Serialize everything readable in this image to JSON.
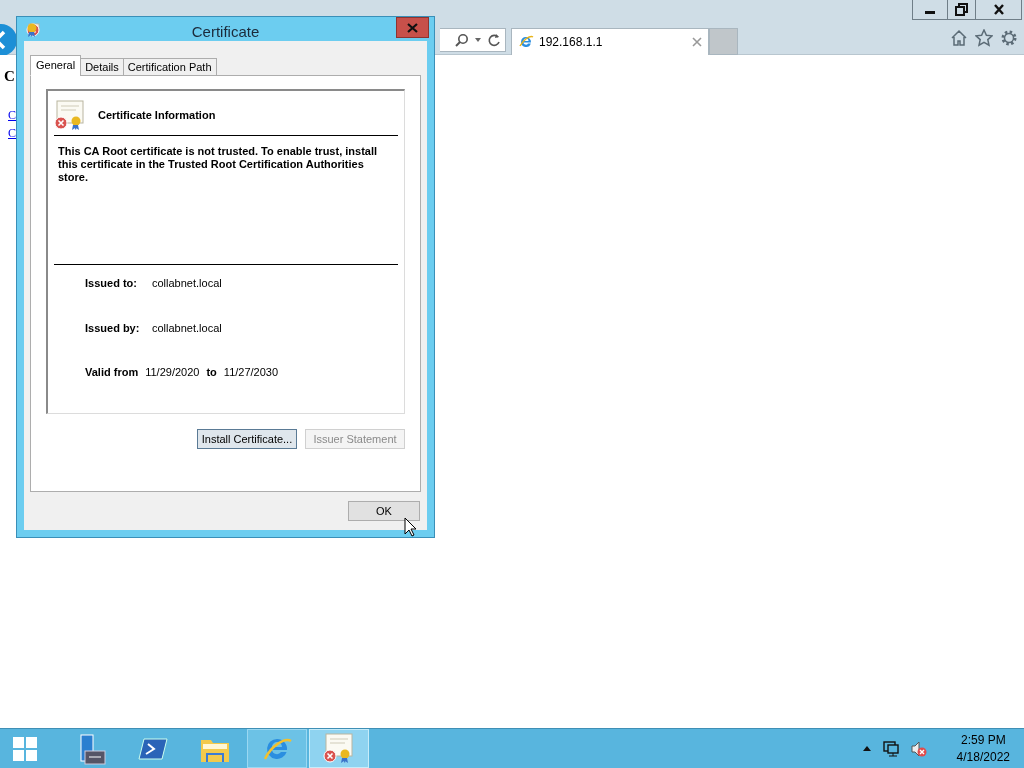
{
  "browser": {
    "page": {
      "heading": "C",
      "links": [
        "C",
        "C"
      ]
    },
    "tab": {
      "title": "192.168.1.1"
    }
  },
  "dialog": {
    "title": "Certificate",
    "tabs": [
      {
        "label": "General",
        "selected": true
      },
      {
        "label": "Details",
        "selected": false
      },
      {
        "label": "Certification Path",
        "selected": false
      }
    ],
    "info_title": "Certificate Information",
    "message": "This CA Root certificate is not trusted. To enable trust, install this certificate in the Trusted Root Certification Authorities store.",
    "fields": [
      {
        "label": "Issued to:",
        "value": "collabnet.local"
      },
      {
        "label": "Issued by:",
        "value": "collabnet.local"
      }
    ],
    "valid": {
      "label": "Valid from",
      "from": "11/29/2020",
      "to_label": "to",
      "to": "11/27/2030"
    },
    "buttons": [
      {
        "label": "Install Certificate...",
        "disabled": false
      },
      {
        "label": "Issuer Statement",
        "disabled": true
      }
    ],
    "ok": "OK"
  },
  "taskbar": {
    "apps": [
      {
        "kind": "server-manager",
        "running": false,
        "selected": false
      },
      {
        "kind": "powershell",
        "running": false,
        "selected": false
      },
      {
        "kind": "explorer",
        "running": false,
        "selected": false
      },
      {
        "kind": "ie",
        "running": true,
        "selected": false
      },
      {
        "kind": "certificate",
        "running": true,
        "selected": true
      }
    ],
    "time": "2:59 PM",
    "date": "4/18/2022"
  }
}
